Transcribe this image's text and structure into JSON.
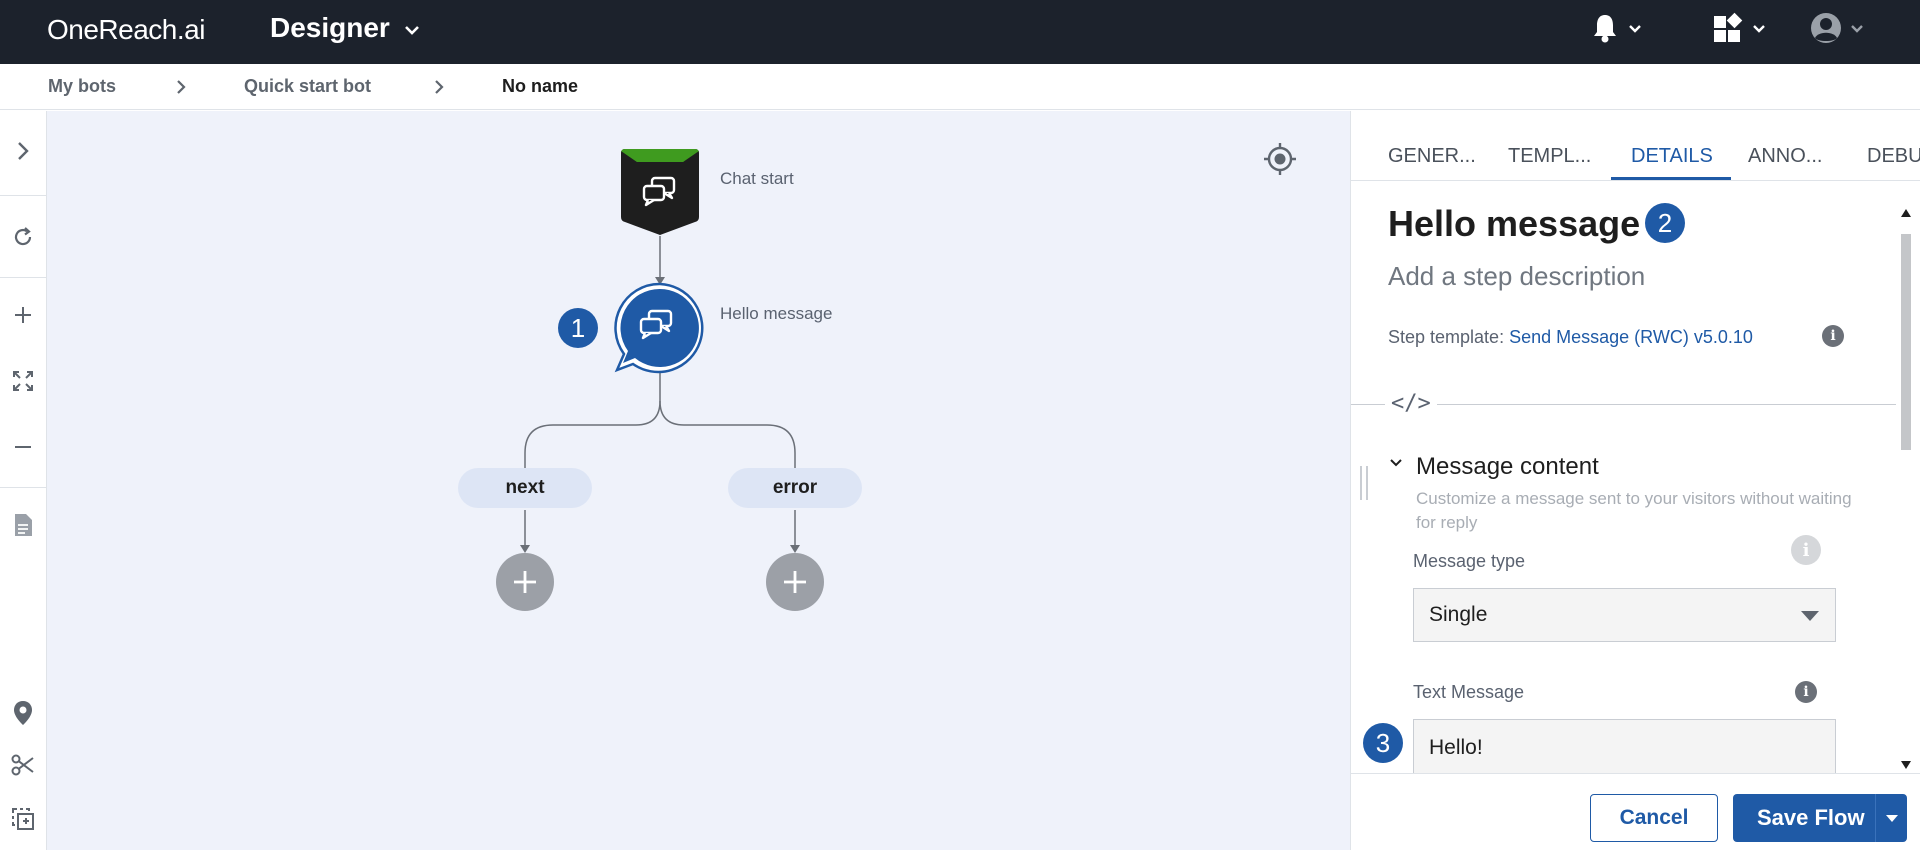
{
  "header": {
    "logo": "OneReach.ai",
    "app_name": "Designer"
  },
  "breadcrumb": {
    "items": [
      "My bots",
      "Quick start bot",
      "No name"
    ]
  },
  "canvas": {
    "nodes": {
      "chat_start": {
        "label": "Chat start"
      },
      "hello_message": {
        "label": "Hello message",
        "badge": "1"
      }
    },
    "branches": {
      "next": "next",
      "error": "error"
    }
  },
  "panel": {
    "tabs": [
      {
        "label": "GENER...",
        "active": false
      },
      {
        "label": "TEMPL...",
        "active": false
      },
      {
        "label": "DETAILS",
        "active": true
      },
      {
        "label": "ANNO...",
        "active": false
      },
      {
        "label": "DEBU",
        "active": false
      }
    ],
    "step_title": "Hello message",
    "title_badge": "2",
    "step_description": "Add a step description",
    "step_template_prefix": "Step template:",
    "step_template_link": "Send Message (RWC) v5.0.10",
    "code_toggle": "</>",
    "section": {
      "title": "Message content",
      "description": "Customize a message sent to your visitors without waiting for reply"
    },
    "message_type": {
      "label": "Message type",
      "value": "Single"
    },
    "text_message": {
      "label": "Text Message",
      "value": "Hello!",
      "badge": "3"
    },
    "info_glyph": "i",
    "footer": {
      "cancel": "Cancel",
      "save": "Save Flow"
    }
  },
  "colors": {
    "topbar": "#1c222c",
    "accent": "#1f5aa6",
    "canvas": "#eff2fa",
    "start_node_top": "#3f9b1f"
  }
}
